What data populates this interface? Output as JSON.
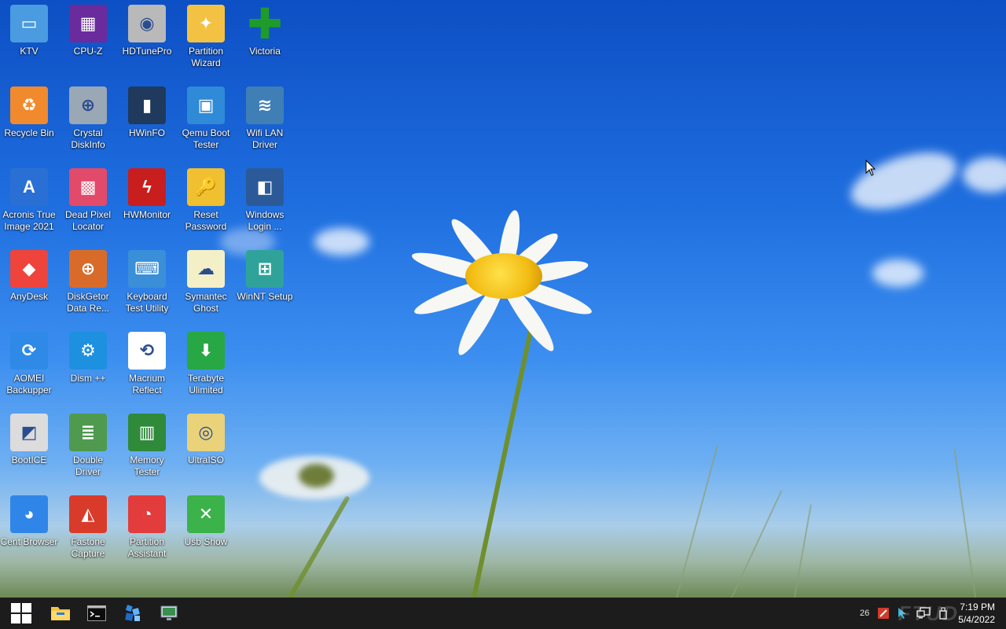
{
  "desktop_icons": [
    {
      "label": "KTV",
      "icon": "monitor-icon",
      "color": "#4a9be0"
    },
    {
      "label": "CPU-Z",
      "icon": "cpu-chip-icon",
      "color": "#6a2c9c"
    },
    {
      "label": "HDTunePro",
      "icon": "hard-drive-icon",
      "color": "#b9b9b9"
    },
    {
      "label": "Partition\nWizard",
      "icon": "magic-wand-icon",
      "color": "#f3c243"
    },
    {
      "label": "Victoria",
      "icon": "green-cross-icon",
      "color": "#1f9b2a"
    },
    {
      "label": "Recycle Bin",
      "icon": "recycle-bin-icon",
      "color": "#f08a2c"
    },
    {
      "label": "Crystal\nDiskInfo",
      "icon": "disk-magnifier-icon",
      "color": "#9aa7b5"
    },
    {
      "label": "HWinFO",
      "icon": "hwinfo-chart-icon",
      "color": "#1f3a5c"
    },
    {
      "label": "Qemu Boot\nTester",
      "icon": "stacked-windows-icon",
      "color": "#2f8ad8"
    },
    {
      "label": "Wifi LAN\nDriver",
      "icon": "wifi-icon",
      "color": "#3f7fb5"
    },
    {
      "label": "Acronis True\nImage 2021",
      "icon": "acronis-a-icon",
      "color": "#2a6fd4"
    },
    {
      "label": "Dead Pixel\nLocator",
      "icon": "color-monitor-icon",
      "color": "#e24a6a"
    },
    {
      "label": "HWMonitor",
      "icon": "lightning-icon",
      "color": "#c81e1e"
    },
    {
      "label": "Reset\nPassword",
      "icon": "padlock-key-icon",
      "color": "#f0c030"
    },
    {
      "label": "Windows\nLogin ...",
      "icon": "user-window-icon",
      "color": "#2c5a99"
    },
    {
      "label": "AnyDesk",
      "icon": "anydesk-diamond-icon",
      "color": "#ef443b"
    },
    {
      "label": "DiskGetor\nData Re...",
      "icon": "disk-magnifier-icon",
      "color": "#d96b2a"
    },
    {
      "label": "Keyboard\nTest Utility",
      "icon": "keyboard-icon",
      "color": "#3a8fd8"
    },
    {
      "label": "Symantec\nGhost",
      "icon": "ghost-icon",
      "color": "#f3f0c8"
    },
    {
      "label": "WinNT Setup",
      "icon": "windows-box-icon",
      "color": "#2fa39a"
    },
    {
      "label": "AOMEI\nBackupper",
      "icon": "sync-arrows-icon",
      "color": "#2e8ae6"
    },
    {
      "label": "Dism ++",
      "icon": "gears-icon",
      "color": "#1e90e0"
    },
    {
      "label": "Macrium\nReflect",
      "icon": "macrium-arrows-icon",
      "color": "#ffffff"
    },
    {
      "label": "Terabyte\nUlimited",
      "icon": "download-drive-icon",
      "color": "#27a844"
    },
    {
      "label": "BootICE",
      "icon": "floppy-icon",
      "color": "#dcdcdc"
    },
    {
      "label": "Double\nDriver",
      "icon": "books-icon",
      "color": "#4f9a4f"
    },
    {
      "label": "Memory\nTester",
      "icon": "ram-module-icon",
      "color": "#2f8a3a"
    },
    {
      "label": "UltraISO",
      "icon": "cd-disc-icon",
      "color": "#e9d27a"
    },
    {
      "label": "Cent Browser",
      "icon": "cent-browser-icon",
      "color": "#2f86e8"
    },
    {
      "label": "Fastone\nCapture",
      "icon": "fastone-capture-icon",
      "color": "#d93b2b"
    },
    {
      "label": "Partition\nAssistant",
      "icon": "partition-disc-icon",
      "color": "#e23c3c"
    },
    {
      "label": "Usb Show",
      "icon": "tools-circle-icon",
      "color": "#3bb24a"
    }
  ],
  "taskbar": {
    "start_icon": "windows-start-icon",
    "pinned": [
      {
        "icon": "file-explorer-icon"
      },
      {
        "icon": "command-prompt-icon"
      },
      {
        "icon": "blocks-app-icon"
      },
      {
        "icon": "display-settings-icon"
      }
    ]
  },
  "tray": {
    "temperature": "26",
    "icons": [
      "red-app-tray-icon",
      "cursor-tray-icon",
      "network-tray-icon",
      "usb-tray-icon"
    ],
    "time": "7:19 PM",
    "date": "5/4/2022"
  },
  "watermark": "FTUD"
}
